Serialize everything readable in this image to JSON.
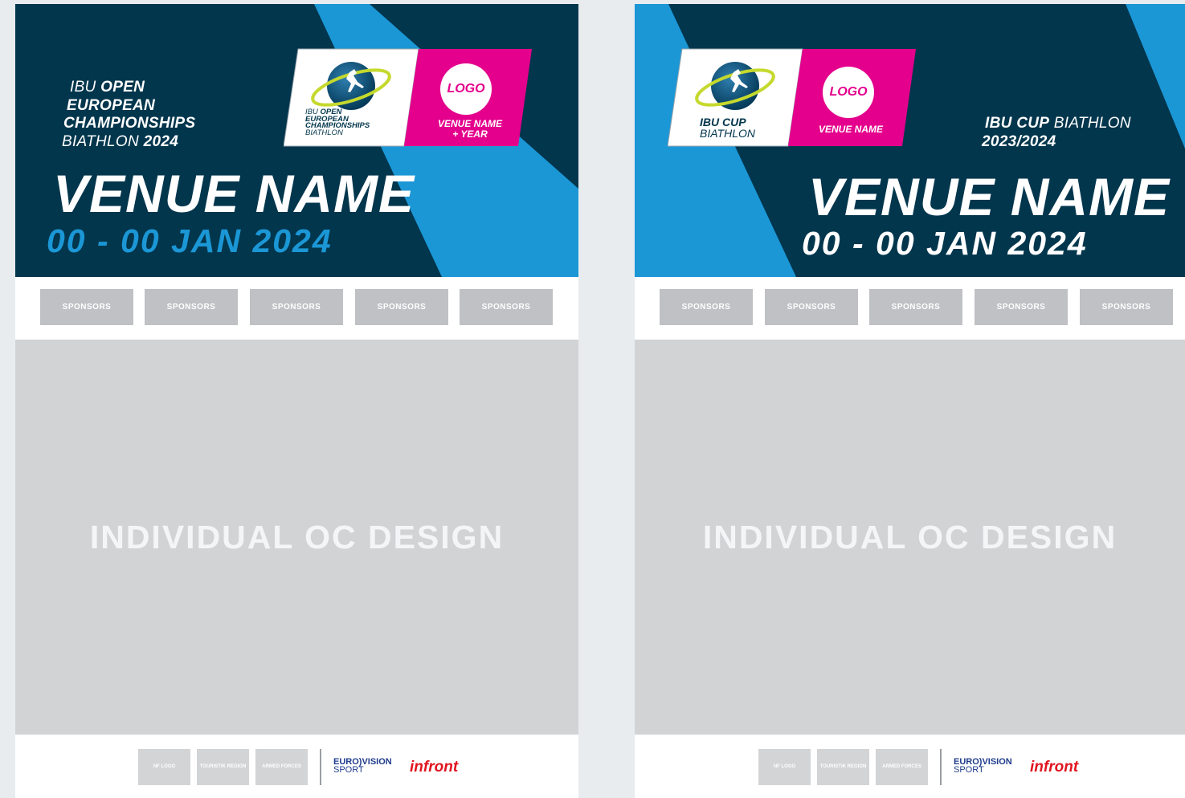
{
  "posters": [
    {
      "event_title": {
        "line1_light": "IBU ",
        "line1_bold": "OPEN",
        "line2": "EUROPEAN",
        "line3": "CHAMPIONSHIPS",
        "line4_light": "BIATHLON ",
        "line4_bold": "2024"
      },
      "logo_card": {
        "event_line1_light": "IBU ",
        "event_line1_bold": "OPEN",
        "event_line2": "EUROPEAN",
        "event_line3": "CHAMPIONSHIPS",
        "event_line4": "BIATHLON",
        "logo_circle": "LOGO",
        "venue_line1": "VENUE NAME",
        "venue_line2": "+ YEAR"
      },
      "venue_name": "VENUE NAME",
      "dates": "00 - 00 JAN 2024",
      "sponsors": [
        "SPONSORS",
        "SPONSORS",
        "SPONSORS",
        "SPONSORS",
        "SPONSORS"
      ],
      "main_placeholder": "INDIVIDUAL OC DESIGN",
      "footer": {
        "nf_logo": "NF LOGO",
        "touristik_region": "TOURISTIK REGION",
        "armed_forces": "ARMED FORCES",
        "eurovision": "EURO)VISION",
        "eurovision_sub": "SPORT",
        "infront": "infront"
      }
    },
    {
      "event_title": {
        "line1_bold": "IBU CUP",
        "line1_light": " BIATHLON",
        "line2": "2023/2024"
      },
      "logo_card": {
        "event_line1": "IBU CUP",
        "event_line2": "BIATHLON",
        "logo_circle": "LOGO",
        "venue_line1": "VENUE NAME"
      },
      "venue_name": "VENUE NAME",
      "dates": "00 - 00 JAN 2024",
      "sponsors": [
        "SPONSORS",
        "SPONSORS",
        "SPONSORS",
        "SPONSORS",
        "SPONSORS"
      ],
      "main_placeholder": "INDIVIDUAL OC DESIGN",
      "footer": {
        "nf_logo": "NF LOGO",
        "touristik_region": "TOURISTIK REGION",
        "armed_forces": "ARMED FORCES",
        "eurovision": "EURO)VISION",
        "eurovision_sub": "SPORT",
        "infront": "infront"
      }
    }
  ],
  "colors": {
    "navy": "#02364d",
    "stripe_blue": "#1b97d6",
    "magenta": "#e4008c",
    "lime": "#c5d92d",
    "sponsor_grey": "#bfc1c4",
    "oc_grey": "#d1d3d5"
  }
}
